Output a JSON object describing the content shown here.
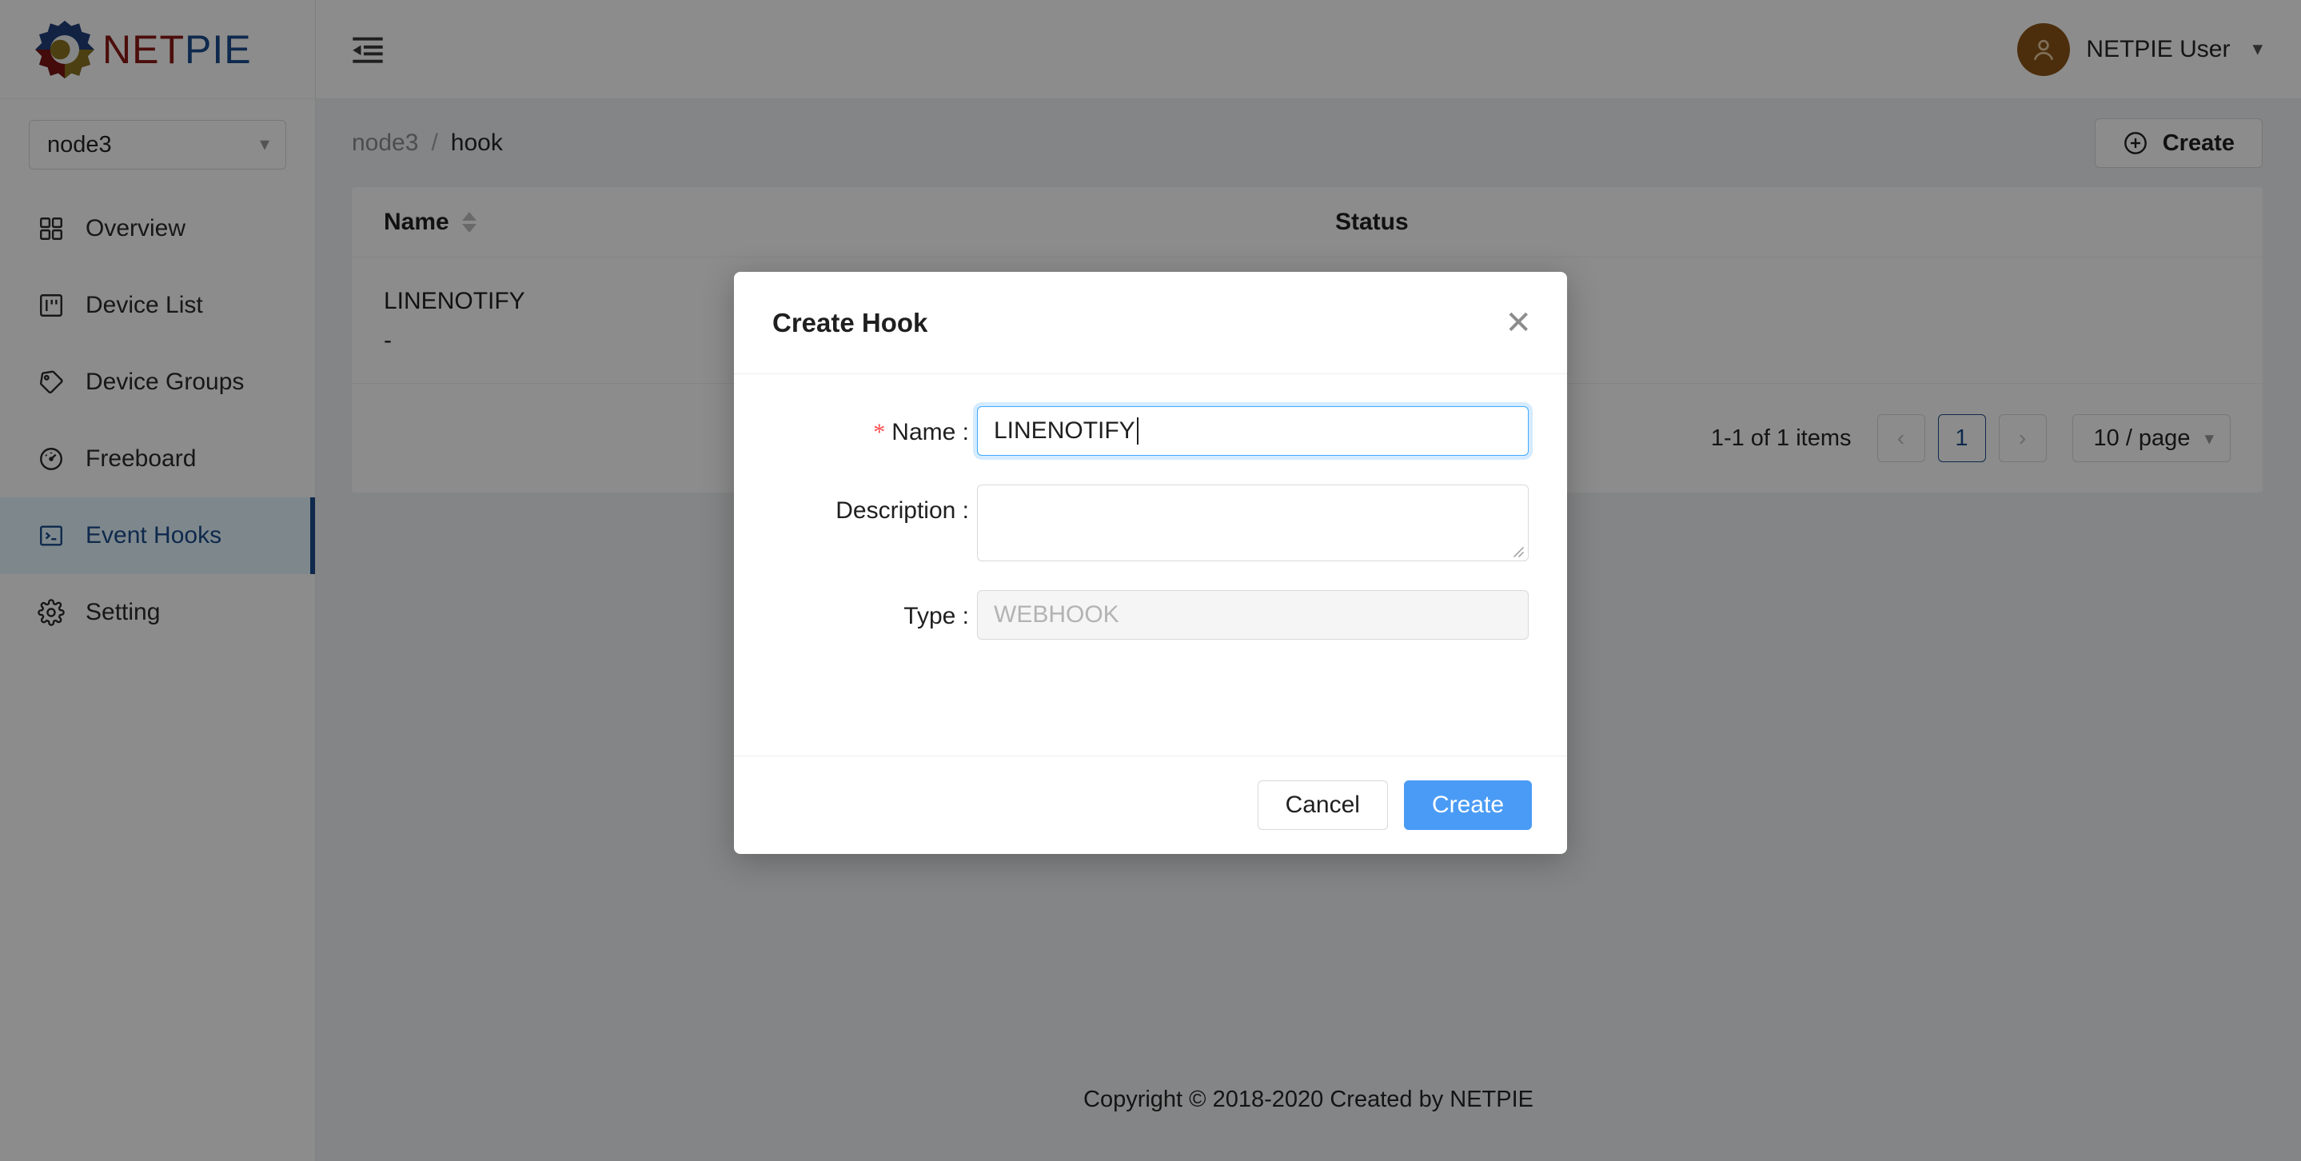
{
  "brand": {
    "name_part1": "NET",
    "name_part2": "PIE",
    "color_net": "#8b1a14",
    "color_pie": "#1b4c8c",
    "logo_icon": "netpie-gear-logo"
  },
  "topbar": {
    "fold_icon": "menu-fold-icon",
    "user_name": "NETPIE User",
    "user_chevron": "chevron-down-icon",
    "avatar_icon": "user-avatar-icon",
    "avatar_color": "#8a5517"
  },
  "sidebar": {
    "project_select": {
      "value": "node3",
      "chevron": "chevron-down-icon"
    },
    "items": [
      {
        "label": "Overview",
        "icon": "appstore-grid-icon",
        "active": false
      },
      {
        "label": "Device List",
        "icon": "device-list-icon",
        "active": false
      },
      {
        "label": "Device Groups",
        "icon": "tag-icon",
        "active": false
      },
      {
        "label": "Freeboard",
        "icon": "dashboard-gauge-icon",
        "active": false
      },
      {
        "label": "Event Hooks",
        "icon": "console-prompt-icon",
        "active": true
      },
      {
        "label": "Setting",
        "icon": "gear-icon",
        "active": false
      }
    ],
    "active_color": "#1b4c8c"
  },
  "breadcrumb": {
    "root": "node3",
    "separator": "/",
    "current": "hook"
  },
  "page_actions": {
    "create_label": "Create",
    "create_icon": "plus-circle-icon"
  },
  "table": {
    "columns": [
      {
        "key": "name",
        "label": "Name",
        "sortable": true
      },
      {
        "key": "status",
        "label": "Status",
        "sortable": false
      }
    ],
    "rows": [
      {
        "name": "LINENOTIFY",
        "description": "-",
        "status": ""
      }
    ]
  },
  "pagination": {
    "total_text": "1-1 of 1 items",
    "prev_icon": "chevron-left-icon",
    "next_icon": "chevron-right-icon",
    "current_page": "1",
    "page_size_label": "10 / page",
    "page_size_chevron": "chevron-down-icon"
  },
  "footer": {
    "copyright": "Copyright © 2018-2020 Created by NETPIE"
  },
  "modal": {
    "title": "Create Hook",
    "close_icon": "close-x-icon",
    "fields": {
      "name": {
        "label": "Name :",
        "required_marker": "*",
        "value": "LINENOTIFY",
        "focused": true
      },
      "description": {
        "label": "Description :",
        "value": "",
        "resize_grip_icon": "resize-grip-icon"
      },
      "type": {
        "label": "Type :",
        "value": "WEBHOOK",
        "disabled": true
      }
    },
    "cancel_label": "Cancel",
    "submit_label": "Create",
    "submit_color": "#4a9bf5"
  }
}
